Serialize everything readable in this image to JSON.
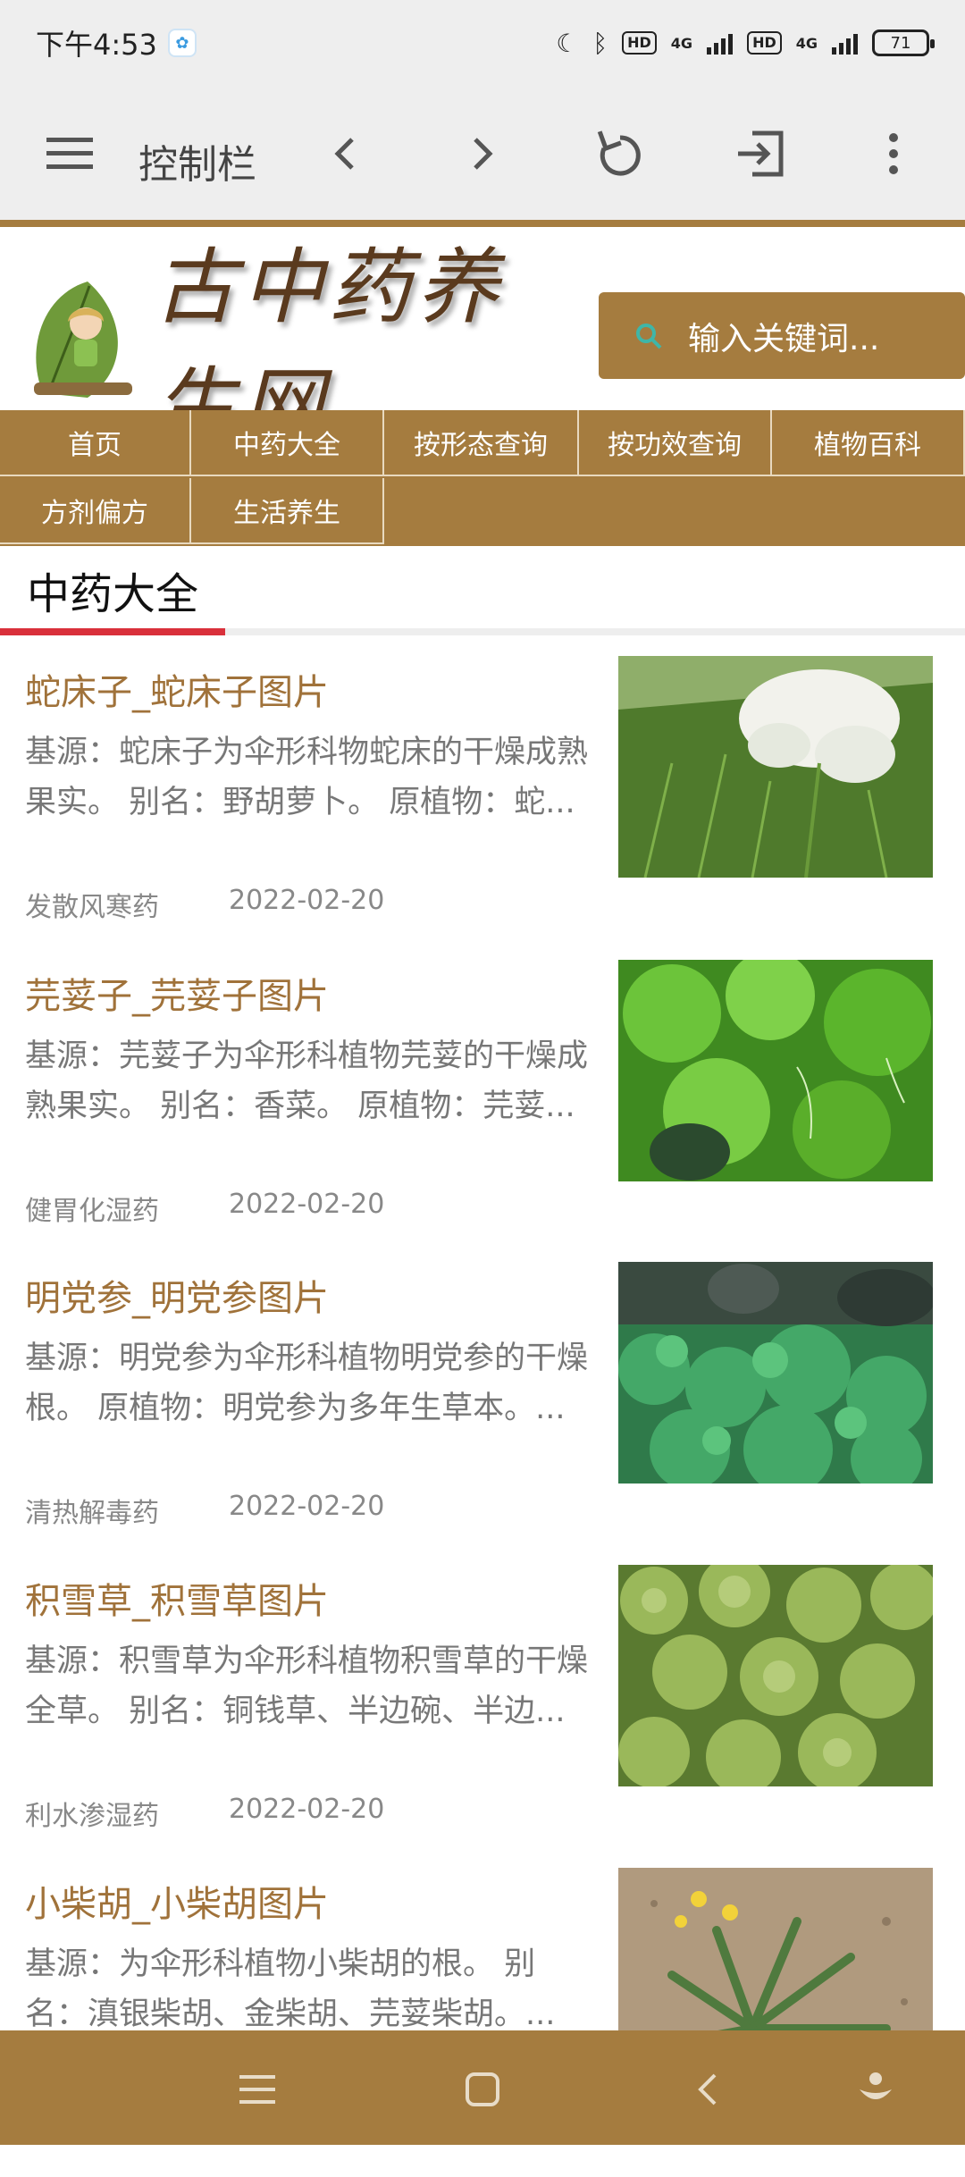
{
  "status_bar": {
    "time": "下午4:53",
    "network_1": "4G",
    "network_2": "4G",
    "hd": "HD",
    "battery": "71"
  },
  "control_bar": {
    "title": "控制栏"
  },
  "header": {
    "logo_text": "古中药养生网",
    "search_placeholder": "输入关键词..."
  },
  "nav": {
    "items": [
      "首页",
      "中药大全",
      "按形态查询",
      "按功效查询",
      "植物百科",
      "方剂偏方",
      "生活养生"
    ]
  },
  "section": {
    "title": "中药大全"
  },
  "articles": [
    {
      "title": "蛇床子_蛇床子图片",
      "desc": "基源：蛇床子为伞形科物蛇床的干燥成熟果实。 别名：野胡萝卜。 原植物：蛇...",
      "category": "发散风寒药",
      "date": "2022-02-20"
    },
    {
      "title": "芫荽子_芫荽子图片",
      "desc": "基源：芫荽子为伞形科植物芫荽的干燥成熟果实。 别名：香菜。 原植物：芫荽...",
      "category": "健胃化湿药",
      "date": "2022-02-20"
    },
    {
      "title": "明党参_明党参图片",
      "desc": "基源：明党参为伞形科植物明党参的干燥根。 原植物：明党参为多年生草本。...",
      "category": "清热解毒药",
      "date": "2022-02-20"
    },
    {
      "title": "积雪草_积雪草图片",
      "desc": "基源：积雪草为伞形科植物积雪草的干燥全草。 别名：铜钱草、半边碗、半边...",
      "category": "利水渗湿药",
      "date": "2022-02-20"
    },
    {
      "title": "小柴胡_小柴胡图片",
      "desc": "基源：为伞形科植物小柴胡的根。 别名：滇银柴胡、金柴胡、芫荽柴胡。...",
      "category": "",
      "date": ""
    }
  ],
  "colors": {
    "brand": "#a57c3f",
    "title_text": "#a0723a",
    "active_underline": "#d9303b",
    "bar_bg": "#eeeeee"
  },
  "icons": [
    "menu-icon",
    "back-chevron-icon",
    "forward-chevron-icon",
    "refresh-icon",
    "exit-icon",
    "more-vertical-icon",
    "search-icon",
    "recent-apps-icon",
    "home-icon",
    "back-nav-icon",
    "assistant-icon"
  ]
}
